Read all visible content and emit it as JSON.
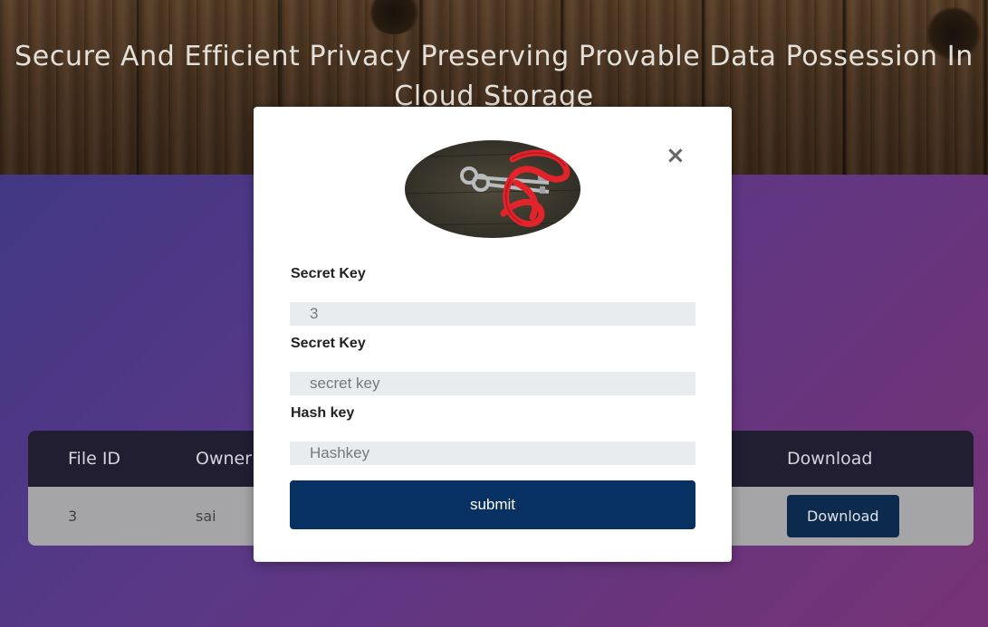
{
  "hero": {
    "title": "Secure And Efficient Privacy Preserving Provable Data Possession In Cloud Storage"
  },
  "table": {
    "headers": [
      "File ID",
      "Owner",
      "Download"
    ],
    "rows": [
      {
        "file_id": "3",
        "owner": "sai",
        "download_label": "Download"
      }
    ]
  },
  "modal": {
    "close_icon": "×",
    "logo_alt": "keys with red rope",
    "fields": [
      {
        "label": "Secret Key",
        "value": "3",
        "placeholder": ""
      },
      {
        "label": "Secret Key",
        "value": "",
        "placeholder": "secret key"
      },
      {
        "label": "Hash key",
        "value": "",
        "placeholder": "Hashkey"
      }
    ],
    "submit_label": "submit"
  },
  "colors": {
    "header_bg": "#221f33",
    "row_bg": "#a9a9ab",
    "primary": "#083163",
    "download_btn": "#0d2b4f"
  }
}
